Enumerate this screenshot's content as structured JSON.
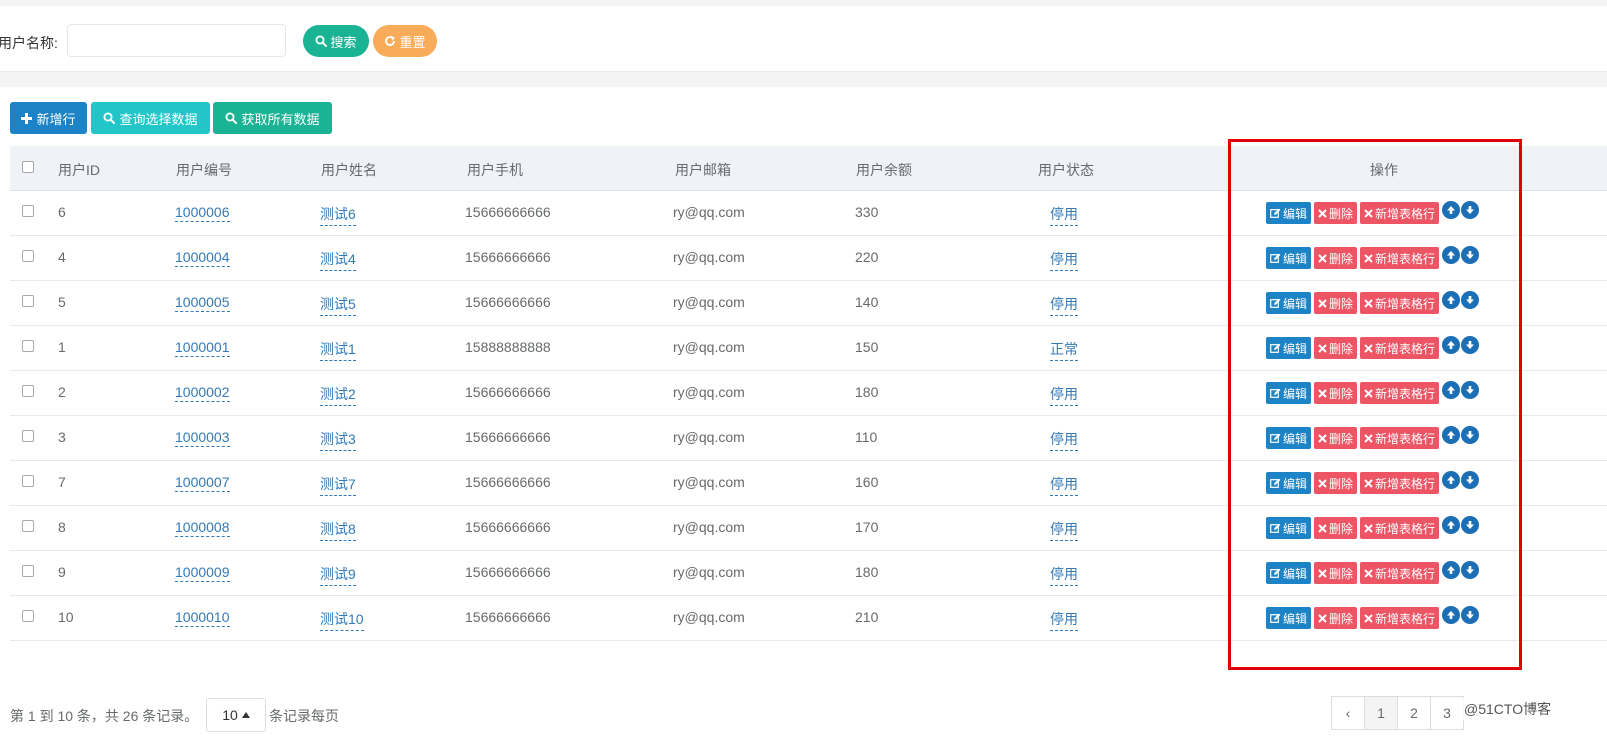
{
  "search": {
    "label": "用户名称:",
    "placeholder": "",
    "search_button": "搜索",
    "reset_button": "重置"
  },
  "toolbar": {
    "add_label": "新增行",
    "query_label": "查询选择数据",
    "getall_label": "获取所有数据"
  },
  "table": {
    "headers": {
      "id": "用户ID",
      "code": "用户编号",
      "name": "用户姓名",
      "phone": "用户手机",
      "email": "用户邮箱",
      "balance": "用户余额",
      "status": "用户状态",
      "ops": "操作"
    },
    "op_labels": {
      "edit": "编辑",
      "delete": "删除",
      "add_row": "新增表格行"
    },
    "rows": [
      {
        "id": "6",
        "code": "1000006",
        "name": "测试6",
        "phone": "15666666666",
        "email": "ry@qq.com",
        "balance": "330",
        "status": "停用"
      },
      {
        "id": "4",
        "code": "1000004",
        "name": "测试4",
        "phone": "15666666666",
        "email": "ry@qq.com",
        "balance": "220",
        "status": "停用"
      },
      {
        "id": "5",
        "code": "1000005",
        "name": "测试5",
        "phone": "15666666666",
        "email": "ry@qq.com",
        "balance": "140",
        "status": "停用"
      },
      {
        "id": "1",
        "code": "1000001",
        "name": "测试1",
        "phone": "15888888888",
        "email": "ry@qq.com",
        "balance": "150",
        "status": "正常"
      },
      {
        "id": "2",
        "code": "1000002",
        "name": "测试2",
        "phone": "15666666666",
        "email": "ry@qq.com",
        "balance": "180",
        "status": "停用"
      },
      {
        "id": "3",
        "code": "1000003",
        "name": "测试3",
        "phone": "15666666666",
        "email": "ry@qq.com",
        "balance": "110",
        "status": "停用"
      },
      {
        "id": "7",
        "code": "1000007",
        "name": "测试7",
        "phone": "15666666666",
        "email": "ry@qq.com",
        "balance": "160",
        "status": "停用"
      },
      {
        "id": "8",
        "code": "1000008",
        "name": "测试8",
        "phone": "15666666666",
        "email": "ry@qq.com",
        "balance": "170",
        "status": "停用"
      },
      {
        "id": "9",
        "code": "1000009",
        "name": "测试9",
        "phone": "15666666666",
        "email": "ry@qq.com",
        "balance": "180",
        "status": "停用"
      },
      {
        "id": "10",
        "code": "1000010",
        "name": "测试10",
        "phone": "15666666666",
        "email": "ry@qq.com",
        "balance": "210",
        "status": "停用"
      }
    ]
  },
  "footer": {
    "info": "第 1 到 10 条，共 26 条记录。",
    "page_size": "10",
    "suffix": "条记录每页"
  },
  "pagination": {
    "prev": "‹",
    "pages": [
      "1",
      "2",
      "3"
    ],
    "active_page": "1"
  },
  "watermark": "@51CTO博客",
  "colors": {
    "primary": "#1c84c6",
    "success": "#1ab394",
    "info": "#23c6c8",
    "warning": "#f8ac59",
    "danger": "#ed5565",
    "highlight": "#e30000"
  },
  "icons": {
    "search": "search-icon",
    "reset": "refresh-icon",
    "add": "plus-icon",
    "edit": "edit-icon",
    "delete": "times-icon",
    "up": "arrow-circle-up-icon",
    "down": "arrow-circle-down-icon",
    "dropdown": "caret-up-icon"
  }
}
